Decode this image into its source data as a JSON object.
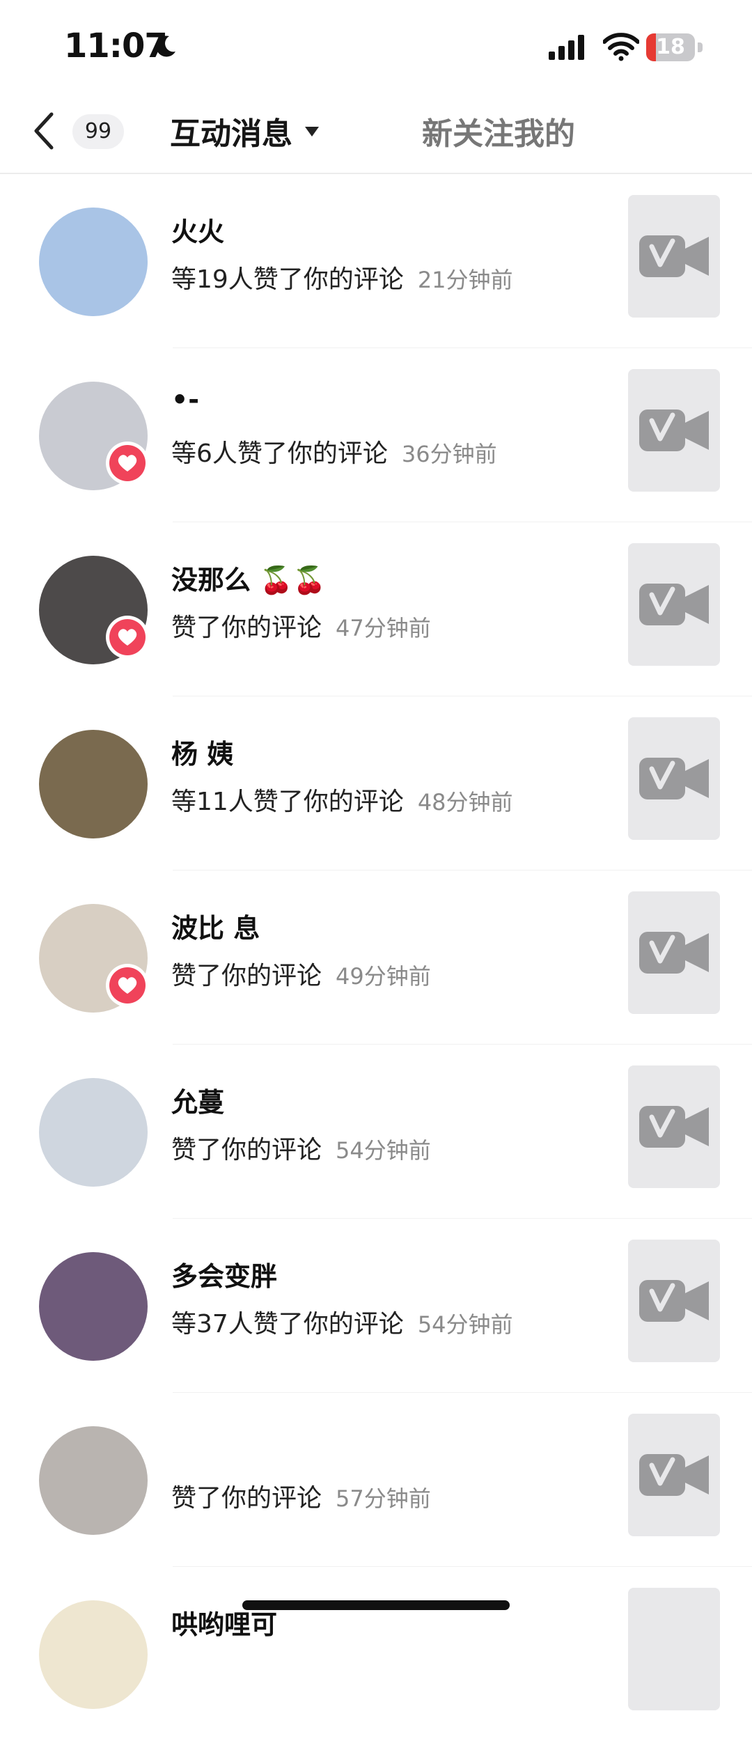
{
  "status_bar": {
    "time": "11:07",
    "battery": "18"
  },
  "nav": {
    "badge_count": "99",
    "active_tab": "互动消息",
    "other_tab": "新关注我的"
  },
  "notifications": [
    {
      "name": "火火",
      "message": "等19人赞了你的评论",
      "time": "21分钟前",
      "heart": false,
      "avatar_color": "#a9c4e6"
    },
    {
      "name": "•-",
      "message": "等6人赞了你的评论",
      "time": "36分钟前",
      "heart": true,
      "avatar_color": "#c9cbd2"
    },
    {
      "name": "没那么 🍒🍒",
      "message": "赞了你的评论",
      "time": "47分钟前",
      "heart": true,
      "avatar_color": "#4d4a4a"
    },
    {
      "name": "杨 姨",
      "message": "等11人赞了你的评论",
      "time": "48分钟前",
      "heart": false,
      "avatar_color": "#7a6a4f"
    },
    {
      "name": "波比 息",
      "message": "赞了你的评论",
      "time": "49分钟前",
      "heart": true,
      "avatar_color": "#d8cfc3"
    },
    {
      "name": "允蔓",
      "message": "赞了你的评论",
      "time": "54分钟前",
      "heart": false,
      "avatar_color": "#cfd6df"
    },
    {
      "name": "多会变胖",
      "message": "等37人赞了你的评论",
      "time": "54分钟前",
      "heart": false,
      "avatar_color": "#6e5a7a"
    },
    {
      "name": "",
      "message": "赞了你的评论",
      "time": "57分钟前",
      "heart": false,
      "avatar_color": "#b9b4b0"
    },
    {
      "name": "哄哟哩可",
      "message": "",
      "time": "",
      "heart": false,
      "avatar_color": "#eee6d0"
    }
  ],
  "colors": {
    "accent": "#f0435a",
    "thumb_bg": "#e8e8ea",
    "thumb_icon": "#9a9a9c"
  }
}
